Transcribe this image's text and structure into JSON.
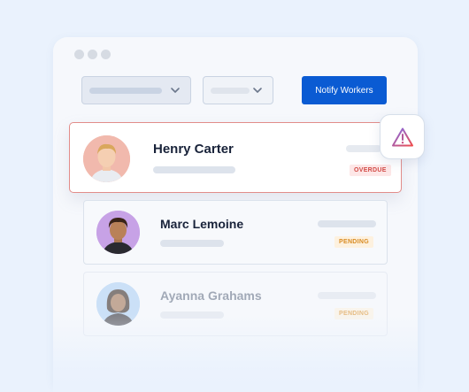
{
  "toolbar": {
    "notify_label": "Notify Workers"
  },
  "workers": [
    {
      "name": "Henry Carter",
      "status": "OVERDUE",
      "status_color": "#d24b46"
    },
    {
      "name": "Marc Lemoine",
      "status": "PENDING",
      "status_color": "#d98c22"
    },
    {
      "name": "Ayanna Grahams",
      "status": "PENDING",
      "status_color": "#d98c22"
    }
  ],
  "alert": {
    "icon": "warning-triangle-icon"
  },
  "colors": {
    "accent": "#0a5bd3",
    "overdue_border": "#e28d8a"
  }
}
